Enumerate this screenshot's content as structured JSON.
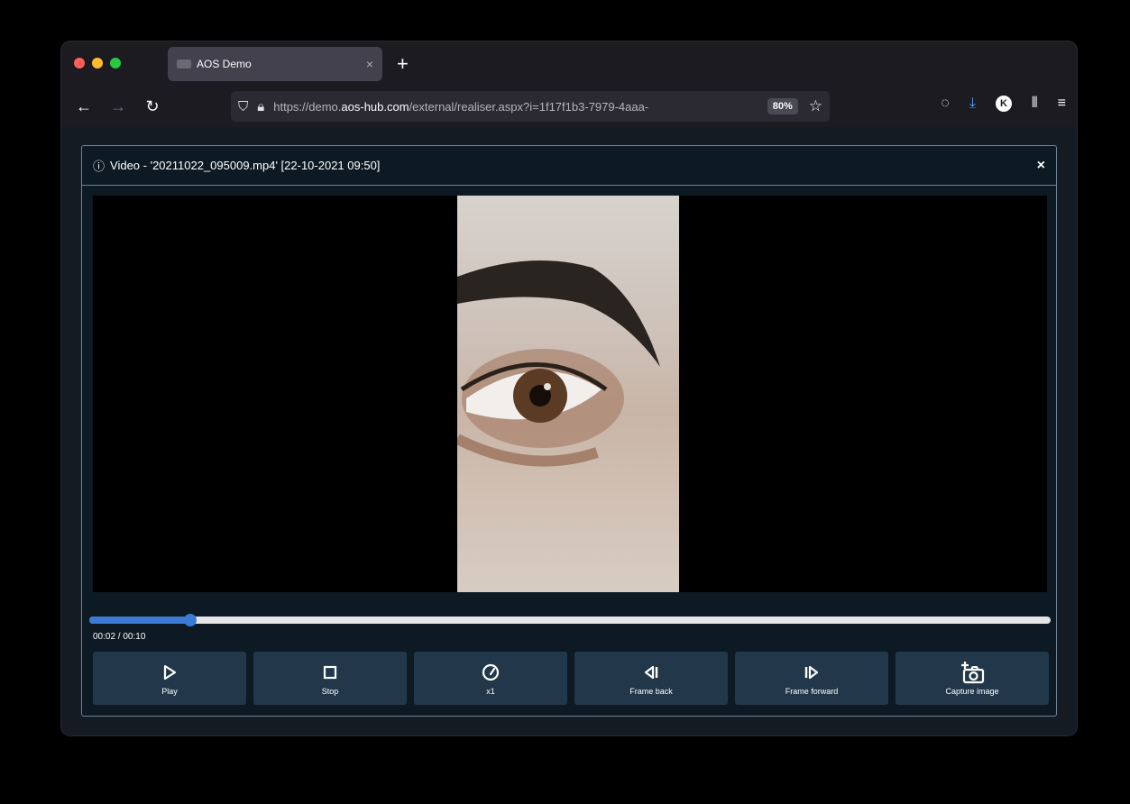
{
  "browser": {
    "tab_title": "AOS Demo",
    "tab_close": "×",
    "new_tab": "+",
    "url_prefix": "https://demo.",
    "url_host": "aos-hub.com",
    "url_path": "/external/realiser.aspx?i=1f17f1b3-7979-4aaa-",
    "zoom": "80%"
  },
  "modal": {
    "title": "Video - '20211022_095009.mp4' [22-10-2021 09:50]",
    "close": "×"
  },
  "player": {
    "time": "00:02 / 00:10",
    "progress_fraction": 0.105,
    "controls": [
      {
        "label": "Play",
        "icon": "play-icon"
      },
      {
        "label": "Stop",
        "icon": "stop-icon"
      },
      {
        "label": "x1",
        "icon": "speed-gauge-icon"
      },
      {
        "label": "Frame back",
        "icon": "frame-back-icon"
      },
      {
        "label": "Frame forward",
        "icon": "frame-forward-icon"
      },
      {
        "label": "Capture image",
        "icon": "camera-add-icon"
      }
    ]
  },
  "colors": {
    "modal_bg": "#0d1a23",
    "control_bg": "#22384a",
    "progress_fill": "#3a7bd5"
  }
}
